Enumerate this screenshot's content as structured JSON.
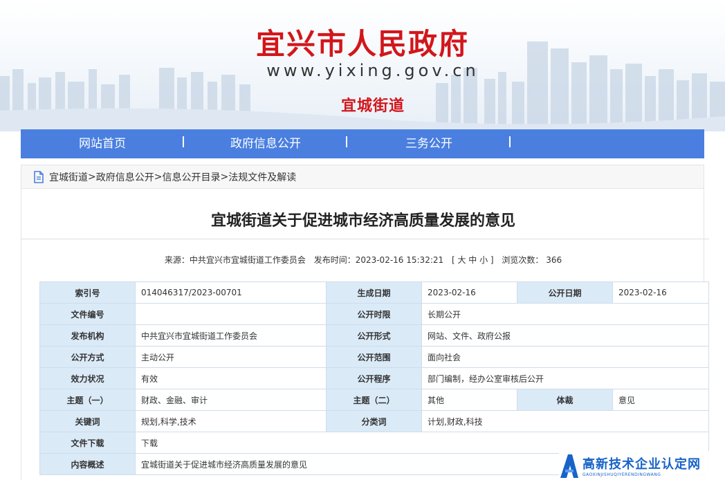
{
  "header": {
    "site_title": "宜兴市人民政府",
    "site_url": "www.yixing.gov.cn",
    "site_subtitle": "宜城街道"
  },
  "nav": {
    "items": [
      {
        "label": "网站首页"
      },
      {
        "label": "政府信息公开"
      },
      {
        "label": "三务公开"
      }
    ]
  },
  "breadcrumb": {
    "items": [
      "宜城街道",
      ">",
      "政府信息公开",
      ">",
      "信息公开目录",
      ">",
      "法规文件及解读"
    ]
  },
  "article": {
    "title": "宜城街道关于促进城市经济高质量发展的意见",
    "meta": {
      "source": "来源：中共宜兴市宜城街道工作委员会",
      "publish_time": "发布时间：2023-02-16 15:32:21",
      "font_size": "[ 大 中 小 ]",
      "views": "浏览次数： 366"
    }
  },
  "info_table": {
    "r1": {
      "l1": "索引号",
      "v1": "014046317/2023-00701",
      "l2": "生成日期",
      "v2": "2023-02-16",
      "l3": "公开日期",
      "v3": "2023-02-16"
    },
    "r2": {
      "l1": "文件编号",
      "v1": "",
      "l2": "公开时限",
      "v2": "长期公开"
    },
    "r3": {
      "l1": "发布机构",
      "v1": "中共宜兴市宜城街道工作委员会",
      "l2": "公开形式",
      "v2": "网站、文件、政府公报"
    },
    "r4": {
      "l1": "公开方式",
      "v1": "主动公开",
      "l2": "公开范围",
      "v2": "面向社会"
    },
    "r5": {
      "l1": "效力状况",
      "v1": "有效",
      "l2": "公开程序",
      "v2": "部门编制，经办公室审核后公开"
    },
    "r6": {
      "l1": "主题（一）",
      "v1": "财政、金融、审计",
      "l2": "主题（二）",
      "v2": "其他",
      "l3": "体裁",
      "v3": "意见"
    },
    "r7": {
      "l1": "关键词",
      "v1": "规划,科学,技术",
      "l2": "分类词",
      "v2": "计划,财政,科技"
    },
    "r8": {
      "l1": "文件下载",
      "v1": "下载"
    },
    "r9": {
      "l1": "内容概述",
      "v1": "宜城街道关于促进城市经济高质量发展的意见"
    }
  },
  "watermark": {
    "text": "高新技术企业认定网",
    "pinyin": "GAOXINJISHUQIYERENDINGWANG"
  },
  "colors": {
    "brand_red": "#d2161b",
    "nav_blue": "#4a7fe0",
    "label_bg": "#dbeaf7",
    "watermark_blue": "#1763c8"
  }
}
